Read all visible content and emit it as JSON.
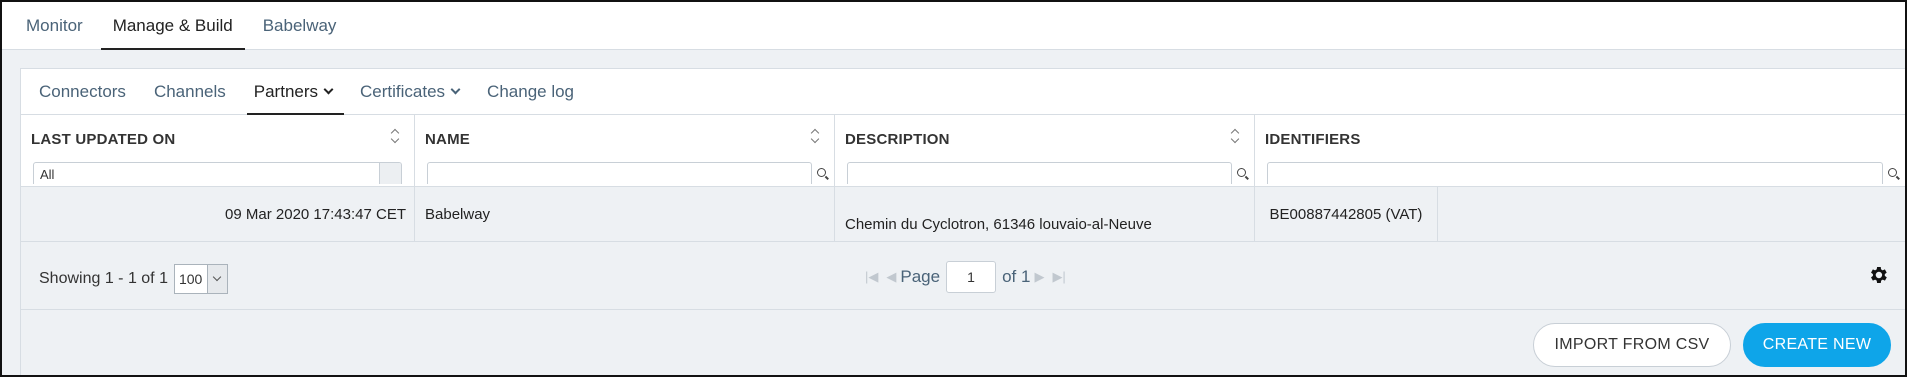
{
  "top_nav": {
    "tabs": [
      "Monitor",
      "Manage & Build",
      "Babelway"
    ]
  },
  "sub_nav": {
    "tabs": [
      "Connectors",
      "Channels",
      "Partners",
      "Certificates",
      "Change log"
    ]
  },
  "grid": {
    "columns": [
      "LAST UPDATED ON",
      "NAME",
      "DESCRIPTION",
      "IDENTIFIERS"
    ],
    "filters": {
      "last_updated_value": "All"
    },
    "rows": [
      {
        "last_updated": "09 Mar 2020 17:43:47 CET",
        "name": "Babelway",
        "description": "Chemin du Cyclotron, 61346 louvaio-al-Neuve",
        "identifiers": "BE00887442805 (VAT)"
      }
    ]
  },
  "pager": {
    "showing": "Showing 1 - 1 of 1",
    "page_size": "100",
    "page_label": "Page",
    "page_value": "1",
    "of_label": "of 1"
  },
  "actions": {
    "import_label": "IMPORT FROM CSV",
    "create_label": "CREATE NEW"
  },
  "colors": {
    "accent": "#0ea5e9",
    "link": "#4a6378"
  }
}
